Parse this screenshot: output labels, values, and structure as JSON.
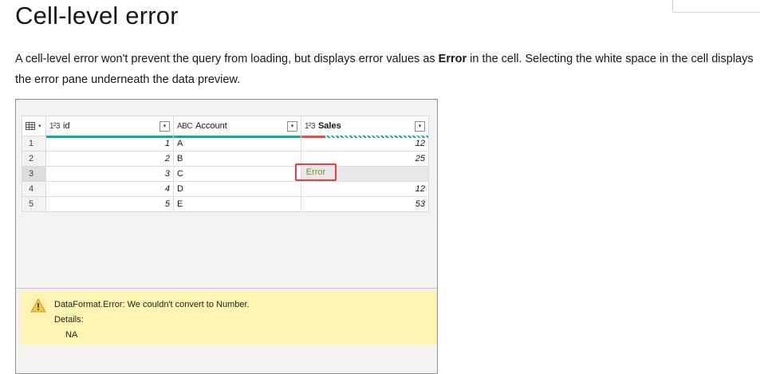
{
  "page": {
    "title": "Cell-level error",
    "paragraph": {
      "before": "A cell-level error won't prevent the query from loading, but displays error values as ",
      "bold": "Error",
      "after": " in the cell. Selecting the white space in the cell displays the error pane underneath the data preview."
    }
  },
  "grid": {
    "columns": [
      {
        "type": "1²3",
        "name": "id"
      },
      {
        "type": "ABC",
        "name": "Account"
      },
      {
        "type": "1²3",
        "name": "Sales"
      }
    ],
    "rows": [
      {
        "num": "1",
        "id": "1",
        "account": "A",
        "sales": "12"
      },
      {
        "num": "2",
        "id": "2",
        "account": "B",
        "sales": "25"
      },
      {
        "num": "3",
        "id": "3",
        "account": "C",
        "sales": "Error"
      },
      {
        "num": "4",
        "id": "4",
        "account": "D",
        "sales": "12"
      },
      {
        "num": "5",
        "id": "5",
        "account": "E",
        "sales": "53"
      }
    ]
  },
  "error_pane": {
    "message": "DataFormat.Error: We couldn't convert to Number.",
    "details_label": "Details:",
    "details_value": "NA"
  },
  "colors": {
    "quality_valid": "#10a99e",
    "quality_error": "#e3504b",
    "highlight_border": "#e2403c",
    "error_pane_bg": "#fdf5b1"
  }
}
